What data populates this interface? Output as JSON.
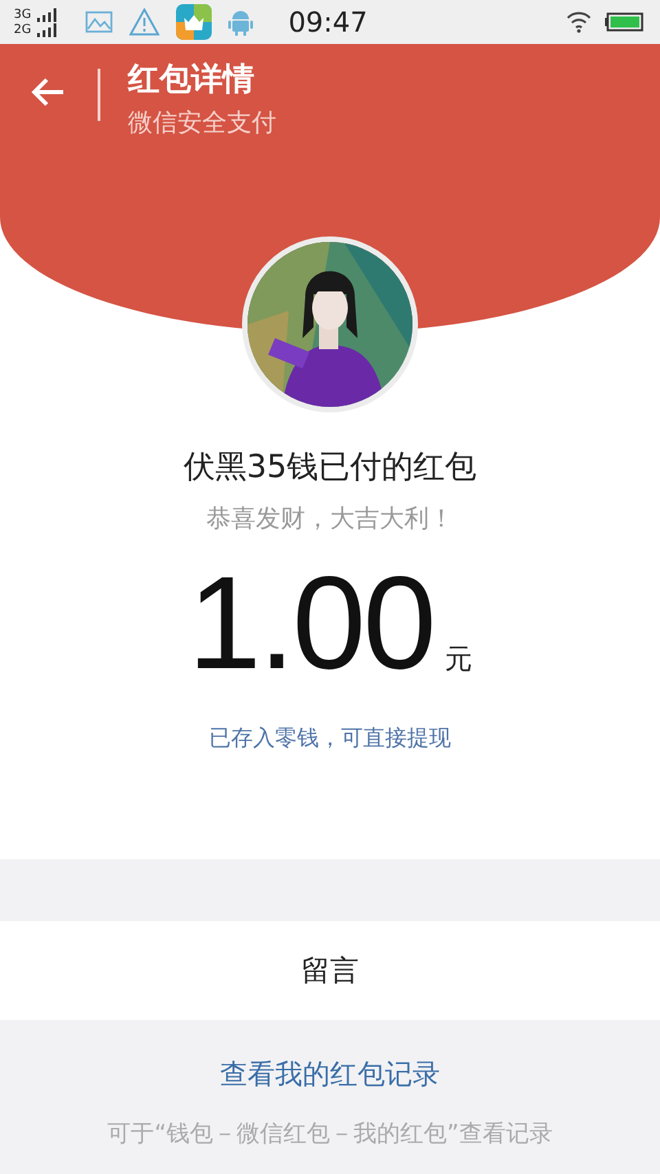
{
  "status_bar": {
    "networks": [
      "3G",
      "2G"
    ],
    "time": "09:47"
  },
  "header": {
    "title": "红包详情",
    "subtitle": "微信安全支付"
  },
  "packet": {
    "sender": "伏黑35钱已付的红包",
    "greeting": "恭喜发财，大吉大利！",
    "amount": "1.00",
    "currency": "元",
    "note": "已存入零钱，可直接提现"
  },
  "message_row": {
    "label": "留言"
  },
  "footer": {
    "link": "查看我的红包记录",
    "hint": "可于“钱包－微信红包－我的红包”查看记录"
  }
}
